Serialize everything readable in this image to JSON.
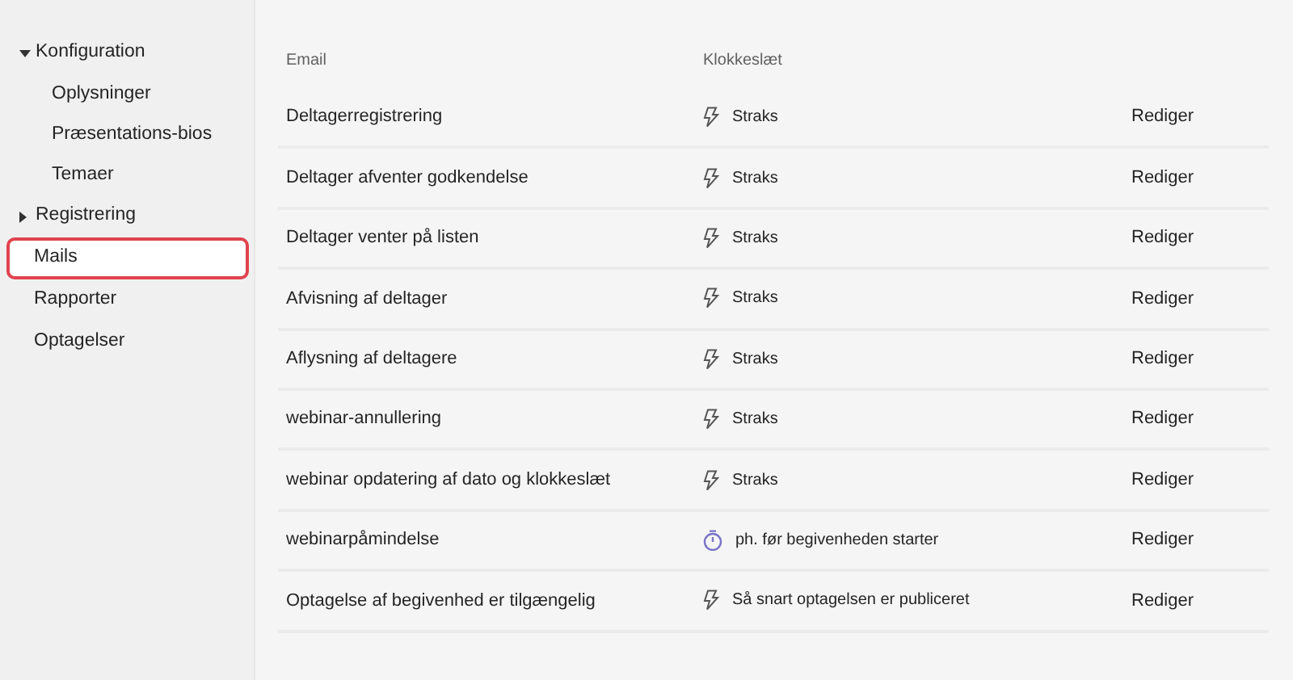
{
  "sidebar": {
    "items": [
      {
        "label": "Konfiguration",
        "expanded": true,
        "selected": false,
        "children": [
          {
            "label": "Oplysninger",
            "selected": false
          },
          {
            "label": "Præsentations-bios",
            "selected": false
          },
          {
            "label": "Temaer",
            "selected": false
          }
        ]
      },
      {
        "label": "Registrering",
        "expanded": false,
        "selected": false
      },
      {
        "label": "Mails",
        "selected": true
      },
      {
        "label": "Rapporter",
        "selected": false
      },
      {
        "label": "Optagelser",
        "selected": false
      }
    ]
  },
  "table": {
    "columns": [
      "Email",
      "Klokkeslæt"
    ],
    "rows": [
      {
        "email": "Deltagerregistrering",
        "kind": "instant",
        "timing": "Straks",
        "action": "Rediger"
      },
      {
        "email": "Deltager afventer godkendelse",
        "kind": "instant",
        "timing": "Straks",
        "action": "Rediger"
      },
      {
        "email": "Deltager venter på listen",
        "kind": "instant",
        "timing": "Straks",
        "action": "Rediger"
      },
      {
        "email": "Afvisning af deltager",
        "kind": "instant",
        "timing": "Straks",
        "action": "Rediger"
      },
      {
        "email": "Aflysning af deltagere",
        "kind": "instant",
        "timing": "Straks",
        "action": "Rediger"
      },
      {
        "email": "webinar-annullering",
        "kind": "instant",
        "timing": "Straks",
        "action": "Rediger"
      },
      {
        "email": "webinar opdatering af dato og klokkeslæt",
        "kind": "instant",
        "timing": "Straks",
        "action": "Rediger"
      },
      {
        "email": "webinarpåmindelse",
        "kind": "timer",
        "timing": "ph. før begivenheden starter",
        "action": "Rediger"
      },
      {
        "email": "Optagelse af begivenhed er tilgængelig",
        "kind": "instant",
        "timing": "Så snart optagelsen er publiceret",
        "action": "Rediger"
      }
    ]
  }
}
